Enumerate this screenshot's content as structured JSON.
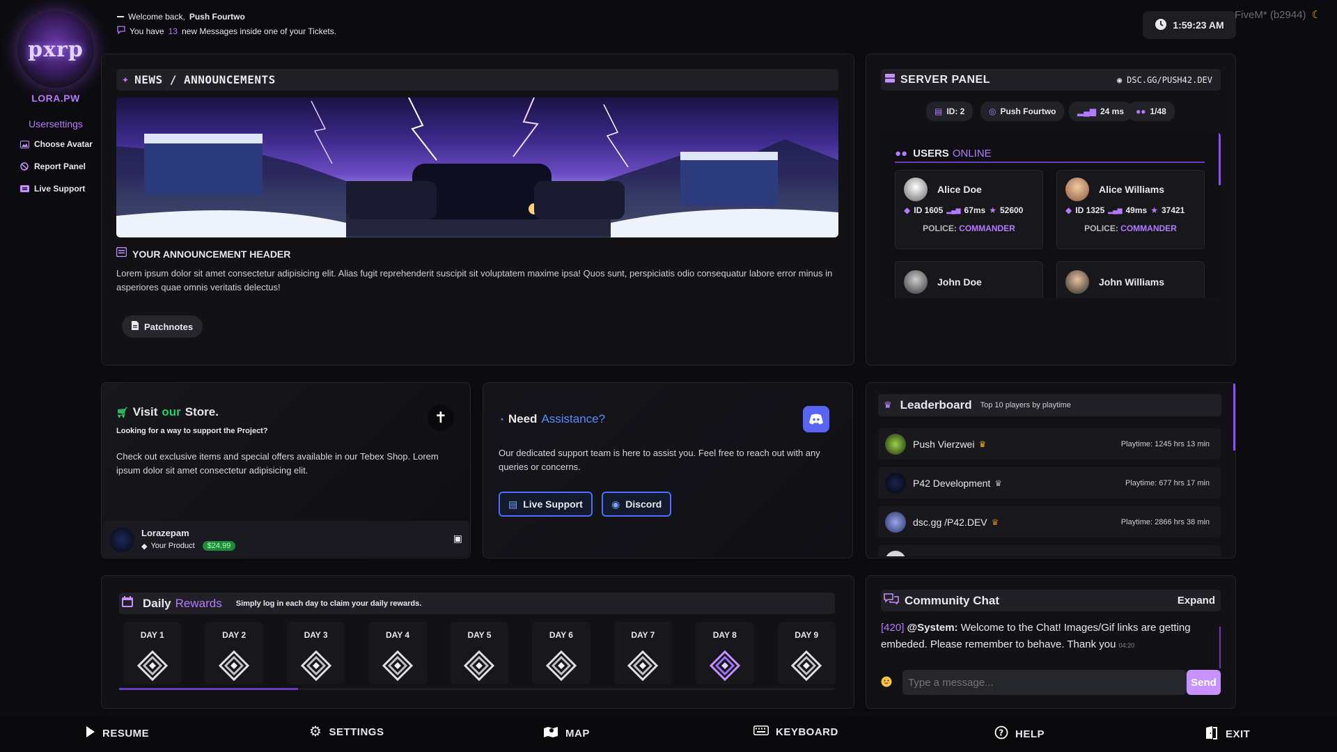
{
  "colors": {
    "accent": "#b57bff",
    "background": "#0c0c10",
    "panel": "#121216",
    "discord": "#5865f2",
    "price": "#1f8a3a"
  },
  "sidebar": {
    "brand": "LORA.PW",
    "section": "Usersettings",
    "items": [
      {
        "label": "Choose Avatar",
        "icon": "image-icon"
      },
      {
        "label": "Report Panel",
        "icon": "ban-icon"
      },
      {
        "label": "Live Support",
        "icon": "ticket-icon"
      }
    ]
  },
  "header": {
    "welcome_prefix": "Welcome back,",
    "username": "Push Fourtwo",
    "msg_prefix": "You have",
    "msg_count": "13",
    "msg_suffix": "new Messages inside one of your Tickets.",
    "time": "1:59:23 AM",
    "build": "FiveM* (b2944)"
  },
  "news": {
    "title": "NEWS / ANNOUNCEMENTS",
    "header": "YOUR ANNOUNCEMENT HEADER",
    "body": "Lorem ipsum dolor sit amet consectetur adipisicing elit. Alias fugit reprehenderit suscipit sit voluptatem maxime ipsa! Quos sunt, perspiciatis odio consequatur labore error minus in asperiores quae omnis veritatis delectus!",
    "button": "Patchnotes"
  },
  "server": {
    "title": "SERVER PANEL",
    "discord": "DSC.GG/PUSH42.DEV",
    "stats": {
      "id": "ID: 2",
      "name": "Push Fourtwo",
      "ping": "24 ms",
      "players": "1/48"
    },
    "users_label": "USERS",
    "users_online": "ONLINE",
    "users": [
      {
        "name": "Alice Doe",
        "id": "ID 1605",
        "ping": "67ms",
        "score": "52600",
        "role_prefix": "POLICE:",
        "role": "COMMANDER"
      },
      {
        "name": "Alice Williams",
        "id": "ID 1325",
        "ping": "49ms",
        "score": "37421",
        "role_prefix": "POLICE:",
        "role": "COMMANDER"
      },
      {
        "name": "John Doe"
      },
      {
        "name": "John Williams"
      }
    ]
  },
  "store": {
    "title_a": "Visit",
    "title_b": "our",
    "title_c": "Store.",
    "subtitle": "Looking for a way to support the Project?",
    "body": "Check out exclusive items and special offers available in our Tebex Shop. Lorem ipsum dolor sit amet consectetur adipisicing elit.",
    "product_user": "Lorazepam",
    "product_name": "Your Product",
    "price": "$24.99"
  },
  "assistance": {
    "title_a": "Need",
    "title_b": "Assistance?",
    "body": "Our dedicated support team is here to assist you. Feel free to reach out with any queries or concerns.",
    "btn_support": "Live Support",
    "btn_discord": "Discord"
  },
  "leaderboard": {
    "title": "Leaderboard",
    "subtitle": "Top 10 players by playtime",
    "rows": [
      {
        "name": "Push Vierzwei",
        "time": "Playtime: 1245 hrs 13 min",
        "trophy_color": "#e6b800"
      },
      {
        "name": "P42 Development",
        "time": "Playtime: 677 hrs 17 min",
        "trophy_color": "#b0b0b8"
      },
      {
        "name": "dsc.gg /P42.DEV",
        "time": "Playtime: 2866 hrs 38 min",
        "trophy_color": "#c9842e"
      }
    ]
  },
  "rewards": {
    "title_a": "Daily",
    "title_b": "Rewards",
    "subtitle": "Simply log in each day to claim your daily rewards.",
    "days": [
      "DAY 1",
      "DAY 2",
      "DAY 3",
      "DAY 4",
      "DAY 5",
      "DAY 6",
      "DAY 7",
      "DAY 8",
      "DAY 9"
    ],
    "progress": 0.25
  },
  "chat": {
    "title": "Community Chat",
    "expand": "Expand",
    "msg_id": "[420]",
    "msg_user": "@System:",
    "msg_text": "Welcome to the Chat! Images/Gif links are getting embeded. Please remember to behave. Thank you",
    "msg_time": "04:20",
    "placeholder": "Type a message...",
    "send": "Send"
  },
  "nav": [
    {
      "label": "RESUME",
      "icon": "play-icon"
    },
    {
      "label": "SETTINGS",
      "icon": "gear-icon"
    },
    {
      "label": "MAP",
      "icon": "map-icon"
    },
    {
      "label": "KEYBOARD",
      "icon": "keyboard-icon"
    },
    {
      "label": "HELP",
      "icon": "help-icon"
    },
    {
      "label": "EXIT",
      "icon": "exit-icon"
    }
  ]
}
